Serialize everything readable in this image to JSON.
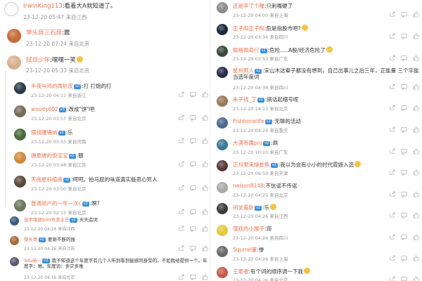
{
  "left_comments": [
    {
      "name": "IrwinKing113",
      "text": ":看着大A就知道了。",
      "time": "23-12-20 05:47",
      "location": "来自江西",
      "avatar": "empty",
      "emoji": false,
      "badge": ""
    },
    {
      "name": "单头蒜三石蒜",
      "text": ":震",
      "time": "23-12-20 07:24",
      "location": "来自北京",
      "avatar": "#c86a3a",
      "emoji": false,
      "badge": ""
    },
    {
      "name": "拭目少年",
      "text": ":嘿嘿一笑",
      "time": "23-12-20 05:33",
      "location": "来自北京",
      "avatar": "#d9b08c",
      "emoji": true,
      "badge": ""
    },
    {
      "name": "半夜叫鸡的周扒皮",
      "text": ":打 打炮的打",
      "time": "23-12-20 04:11",
      "location": "来自浙江",
      "avatar": "#2a3a4a",
      "emoji": false,
      "badge": "v2"
    },
    {
      "name": "woody602",
      "text": ":改成\"饼\"吧",
      "time": "23-12-20 03:57",
      "location": "来自北京",
      "avatar": "#7a6a5a",
      "emoji": false,
      "badge": "v3"
    },
    {
      "name": "摆钱镶锤纳",
      "text": ":乐",
      "time": "23-12-20 03:55",
      "location": "来自河南",
      "avatar": "#4a6a3a",
      "emoji": false,
      "badge": "v2"
    },
    {
      "name": "缠意缠的饱宝宝",
      "text": ":额",
      "time": "23-12-20 03:48",
      "location": "来自江苏",
      "avatar": "#d08a3a",
      "emoji": false,
      "badge": "v2"
    },
    {
      "name": "天南星科植南",
      "text": ":呵呵。拍马屁的味道真实版恶心死人",
      "time": "23-12-20 03:00",
      "location": "来自北京",
      "avatar": "#5a4a3a",
      "emoji": false,
      "badge": "v2"
    },
    {
      "name": "普通用户的一年一次c",
      "text": ":啊?",
      "time": "23-12-20 02:15",
      "location": "来自北京",
      "avatar": "#6a7a5a",
      "emoji": false,
      "badge": "v2"
    },
    {
      "name": "宠宇南德600号李主任",
      "text": ":天天造词",
      "time": "23-12-20 04:26",
      "location": "来自江西",
      "avatar": "#3a5a7a",
      "emoji": false,
      "badge": "v2"
    },
    {
      "name": "黎长青",
      "text": ":要艰不断的振",
      "time": "23-12-20 04:26",
      "location": "来自江苏",
      "avatar": "#a86a3a",
      "emoji": false,
      "badge": "v2"
    },
    {
      "name": "9du新一",
      "text": ":我不知道这个年度字有几个人听到看到能感同身受的。不如我给提供一个。年度字：难。年度词：多灾多难",
      "time": "23-12-20 04:16",
      "location": "来自北京",
      "avatar": "#5a5a6a",
      "emoji": false,
      "badge": "v2"
    }
  ],
  "right_comments": [
    {
      "name": "还是李了个喔",
      "text": ":只刺嘴硬了",
      "time": "23-12-20 04:00",
      "location": "来自上海",
      "avatar": "#8a8a8a",
      "emoji": false,
      "badge": ""
    },
    {
      "name": "王子阳王子阳",
      "text": ":危是指股市吧?",
      "time": "23-12-20 03:34",
      "location": "来自四川",
      "avatar": "#1a2a3a",
      "emoji": true,
      "badge": ""
    },
    {
      "name": "佩格佩奇行",
      "text": ":危险.....A股/经济危险了",
      "time": "23-12-20 03:53",
      "location": "来自广东",
      "avatar": "#3a4a3a",
      "emoji": true,
      "badge": "v2"
    },
    {
      "name": "星州照人",
      "text": ":宋山木这辈子都没有想到，自己出事儿之后三年，正能量 三个字能当选年度词",
      "time": "23-12-20 04:38",
      "location": "来自四川",
      "avatar": "#2a2a4a",
      "emoji": false,
      "badge": "v2"
    },
    {
      "name": "朱子钱_丁",
      "text": ":搞话起缩号呢",
      "time": "23-12-20 14:13",
      "location": "来自北京",
      "avatar": "#9a7a5a",
      "emoji": false,
      "badge": "v2"
    },
    {
      "name": "Fishbonelife",
      "text": ":无聊的活动",
      "time": "23-12-20 04:24",
      "location": "来自重庆",
      "avatar": "#4a6a8a",
      "emoji": false,
      "badge": "v2"
    },
    {
      "name": "大漠苍鹰pro",
      "text": ":跌",
      "time": "23-12-20 10:10",
      "location": "来自广东",
      "avatar": "#3a7a9a",
      "emoji": false,
      "badge": "v2"
    },
    {
      "name": "正月里来燥蛇鱼",
      "text": ":我以为会有小小的时代霓姬入选",
      "time": "23-12-20 06:59",
      "location": "来自天津",
      "avatar": "#5a3a3a",
      "emoji": true,
      "badge": "v2"
    },
    {
      "name": "nelson8148",
      "text": ":不信谣不传谣",
      "time": "23-12-20 04:25",
      "location": "来自北京",
      "avatar": "#aaaaaa",
      "emoji": false,
      "badge": ""
    },
    {
      "name": "闲坐霜卧",
      "text": ":乐",
      "time": "23-12-20 04:26",
      "location": "来自江西",
      "avatar": "#3a3a3a",
      "emoji": true,
      "badge": "v2"
    },
    {
      "name": "强跃的小猴子",
      "text": ":润",
      "time": "23-12-20 04:26",
      "location": "来自四川",
      "avatar": "#e8c83a",
      "emoji": false,
      "badge": ""
    },
    {
      "name": "Squrrel董",
      "text": ":惨",
      "time": "23-12-20 04:26",
      "location": "来自上海",
      "avatar": "#6a6a6a",
      "emoji": false,
      "badge": ""
    },
    {
      "name": "王豪者",
      "text": ":有个词的顺序调一下我",
      "time": "23-12-20 04:26",
      "location": "来自北京",
      "avatar": "#c85a4a",
      "emoji": true,
      "badge": ""
    }
  ]
}
